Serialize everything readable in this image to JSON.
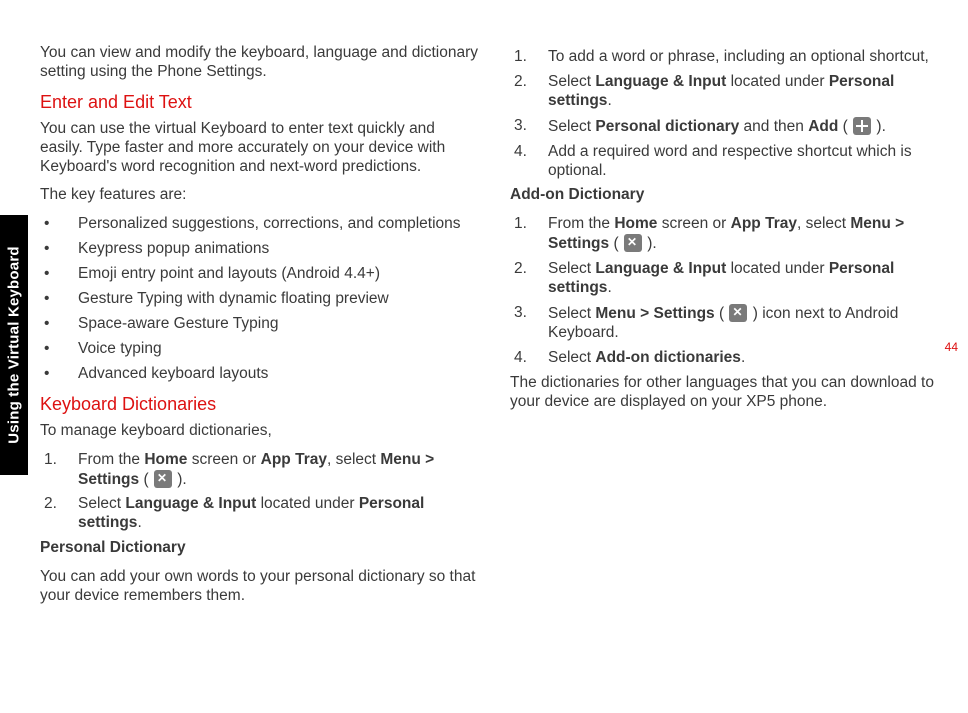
{
  "sideTab": "Using the Virtual Keyboard",
  "pageNumber": "44",
  "left": {
    "intro": "You can view and modify the keyboard, language and dictionary setting using the Phone Settings.",
    "h1": "Enter and Edit Text",
    "p1": "You can use the virtual Keyboard to enter text quickly and easily. Type faster and more accurately on your device with Keyboard's word recognition and next-word predictions.",
    "p2": "The key features are:",
    "features": [
      "Personalized suggestions, corrections, and completions",
      "Keypress popup animations",
      "Emoji entry point and layouts (Android 4.4+)",
      "Gesture Typing with dynamic floating preview",
      "Space-aware Gesture Typing",
      "Voice typing",
      "Advanced keyboard layouts"
    ],
    "h2": "Keyboard Dictionaries",
    "p3": "To manage keyboard dictionaries,",
    "step1_a": "From the ",
    "step1_b": "Home",
    "step1_c": " screen or ",
    "step1_d": "App Tray",
    "step1_e": ", select ",
    "step1_f": "Menu > Settings",
    "step1_g": " ( ",
    "step1_h": " ).",
    "step2_a": "Select ",
    "step2_b": "Language & Input",
    "step2_c": " located under ",
    "step2_d": "Personal settings",
    "step2_e": ".",
    "h3": "Personal Dictionary",
    "p4": "You can add your own words to your personal dictionary so that your device remembers them."
  },
  "right": {
    "pd1": "To add a word or phrase, including an optional shortcut,",
    "pd2_a": "Select ",
    "pd2_b": "Language & Input",
    "pd2_c": " located under ",
    "pd2_d": "Personal settings",
    "pd2_e": ".",
    "pd3_a": "Select ",
    "pd3_b": "Personal dictionary",
    "pd3_c": " and then ",
    "pd3_d": "Add",
    "pd3_e": " ( ",
    "pd3_f": " ).",
    "pd4": "Add a required word and respective shortcut which is optional.",
    "h4": "Add-on Dictionary",
    "ad1_a": "From the ",
    "ad1_b": "Home",
    "ad1_c": " screen or ",
    "ad1_d": "App Tray",
    "ad1_e": ", select ",
    "ad1_f": "Menu > Settings",
    "ad1_g": " ( ",
    "ad1_h": " ).",
    "ad2_a": "Select ",
    "ad2_b": "Language & Input",
    "ad2_c": " located under ",
    "ad2_d": "Personal settings",
    "ad2_e": ".",
    "ad3_a": "Select ",
    "ad3_b": "Menu > Settings",
    "ad3_c": " ( ",
    "ad3_d": " ) icon next to Android Keyboard.",
    "ad4_a": "Select ",
    "ad4_b": "Add-on dictionaries",
    "ad4_c": ".",
    "p5": "The dictionaries for other languages that you can download to your device are displayed on your XP5 phone."
  }
}
